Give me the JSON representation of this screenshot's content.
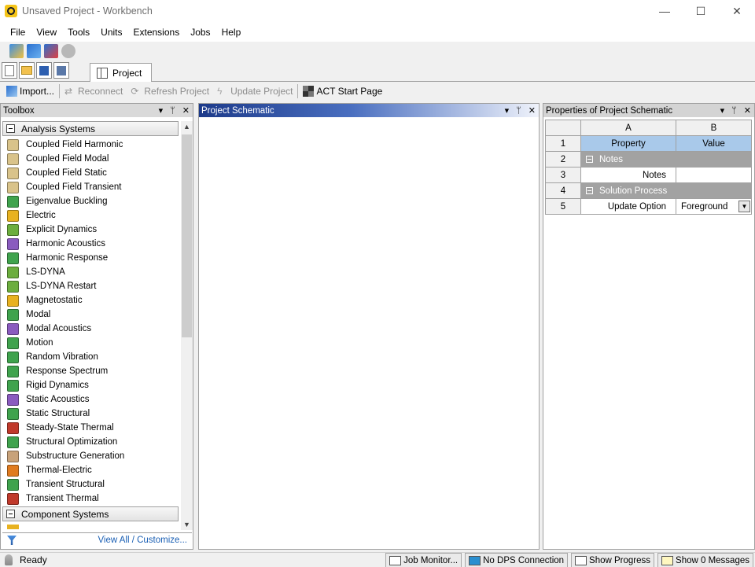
{
  "window": {
    "title": "Unsaved Project - Workbench",
    "controls": [
      "—",
      "☐",
      "✕"
    ]
  },
  "menu": [
    "File",
    "View",
    "Tools",
    "Units",
    "Extensions",
    "Jobs",
    "Help"
  ],
  "tabs": {
    "project_label": "Project"
  },
  "toolbar": {
    "import_label": "Import...",
    "reconnect_label": "Reconnect",
    "refresh_label": "Refresh Project",
    "update_label": "Update Project",
    "act_label": "ACT Start Page"
  },
  "toolbox": {
    "title": "Toolbox",
    "header_controls": [
      "▾",
      "ᛘ",
      "✕"
    ],
    "analysis_group": "Analysis Systems",
    "component_group": "Component Systems",
    "items": [
      {
        "label": "Coupled Field Harmonic",
        "color": "#d9c38a"
      },
      {
        "label": "Coupled Field Modal",
        "color": "#d9c38a"
      },
      {
        "label": "Coupled Field Static",
        "color": "#d9c38a"
      },
      {
        "label": "Coupled Field Transient",
        "color": "#d9c38a"
      },
      {
        "label": "Eigenvalue Buckling",
        "color": "#3fa34d"
      },
      {
        "label": "Electric",
        "color": "#e8b220"
      },
      {
        "label": "Explicit Dynamics",
        "color": "#6cae3e"
      },
      {
        "label": "Harmonic Acoustics",
        "color": "#8a5bbf"
      },
      {
        "label": "Harmonic Response",
        "color": "#3fa34d"
      },
      {
        "label": "LS-DYNA",
        "color": "#6cae3e"
      },
      {
        "label": "LS-DYNA Restart",
        "color": "#6cae3e"
      },
      {
        "label": "Magnetostatic",
        "color": "#e8b220"
      },
      {
        "label": "Modal",
        "color": "#3fa34d"
      },
      {
        "label": "Modal Acoustics",
        "color": "#8a5bbf"
      },
      {
        "label": "Motion",
        "color": "#3fa34d"
      },
      {
        "label": "Random Vibration",
        "color": "#3fa34d"
      },
      {
        "label": "Response Spectrum",
        "color": "#3fa34d"
      },
      {
        "label": "Rigid Dynamics",
        "color": "#3fa34d"
      },
      {
        "label": "Static Acoustics",
        "color": "#8a5bbf"
      },
      {
        "label": "Static Structural",
        "color": "#3fa34d"
      },
      {
        "label": "Steady-State Thermal",
        "color": "#c0392b"
      },
      {
        "label": "Structural Optimization",
        "color": "#3fa34d"
      },
      {
        "label": "Substructure Generation",
        "color": "#c8a27a"
      },
      {
        "label": "Thermal-Electric",
        "color": "#e07b1f"
      },
      {
        "label": "Transient Structural",
        "color": "#3fa34d"
      },
      {
        "label": "Transient Thermal",
        "color": "#c0392b"
      }
    ],
    "footer_link": "View All / Customize..."
  },
  "schematic": {
    "title": "Project Schematic",
    "header_controls": [
      "▾",
      "ᛘ",
      "✕"
    ]
  },
  "properties": {
    "title": "Properties of Project Schematic",
    "header_controls": [
      "▾",
      "ᛘ",
      "✕"
    ],
    "col_a": "A",
    "col_b": "B",
    "rows": {
      "r1": {
        "num": "1",
        "a": "Property",
        "b": "Value"
      },
      "r2": {
        "num": "2",
        "group": "Notes"
      },
      "r3": {
        "num": "3",
        "a": "Notes",
        "b": ""
      },
      "r4": {
        "num": "4",
        "group": "Solution Process"
      },
      "r5": {
        "num": "5",
        "a": "Update Option",
        "b": "Foreground"
      }
    }
  },
  "status": {
    "text": "Ready",
    "job_monitor": "Job Monitor...",
    "dps": "No DPS Connection",
    "progress": "Show Progress",
    "messages": "Show 0 Messages"
  }
}
